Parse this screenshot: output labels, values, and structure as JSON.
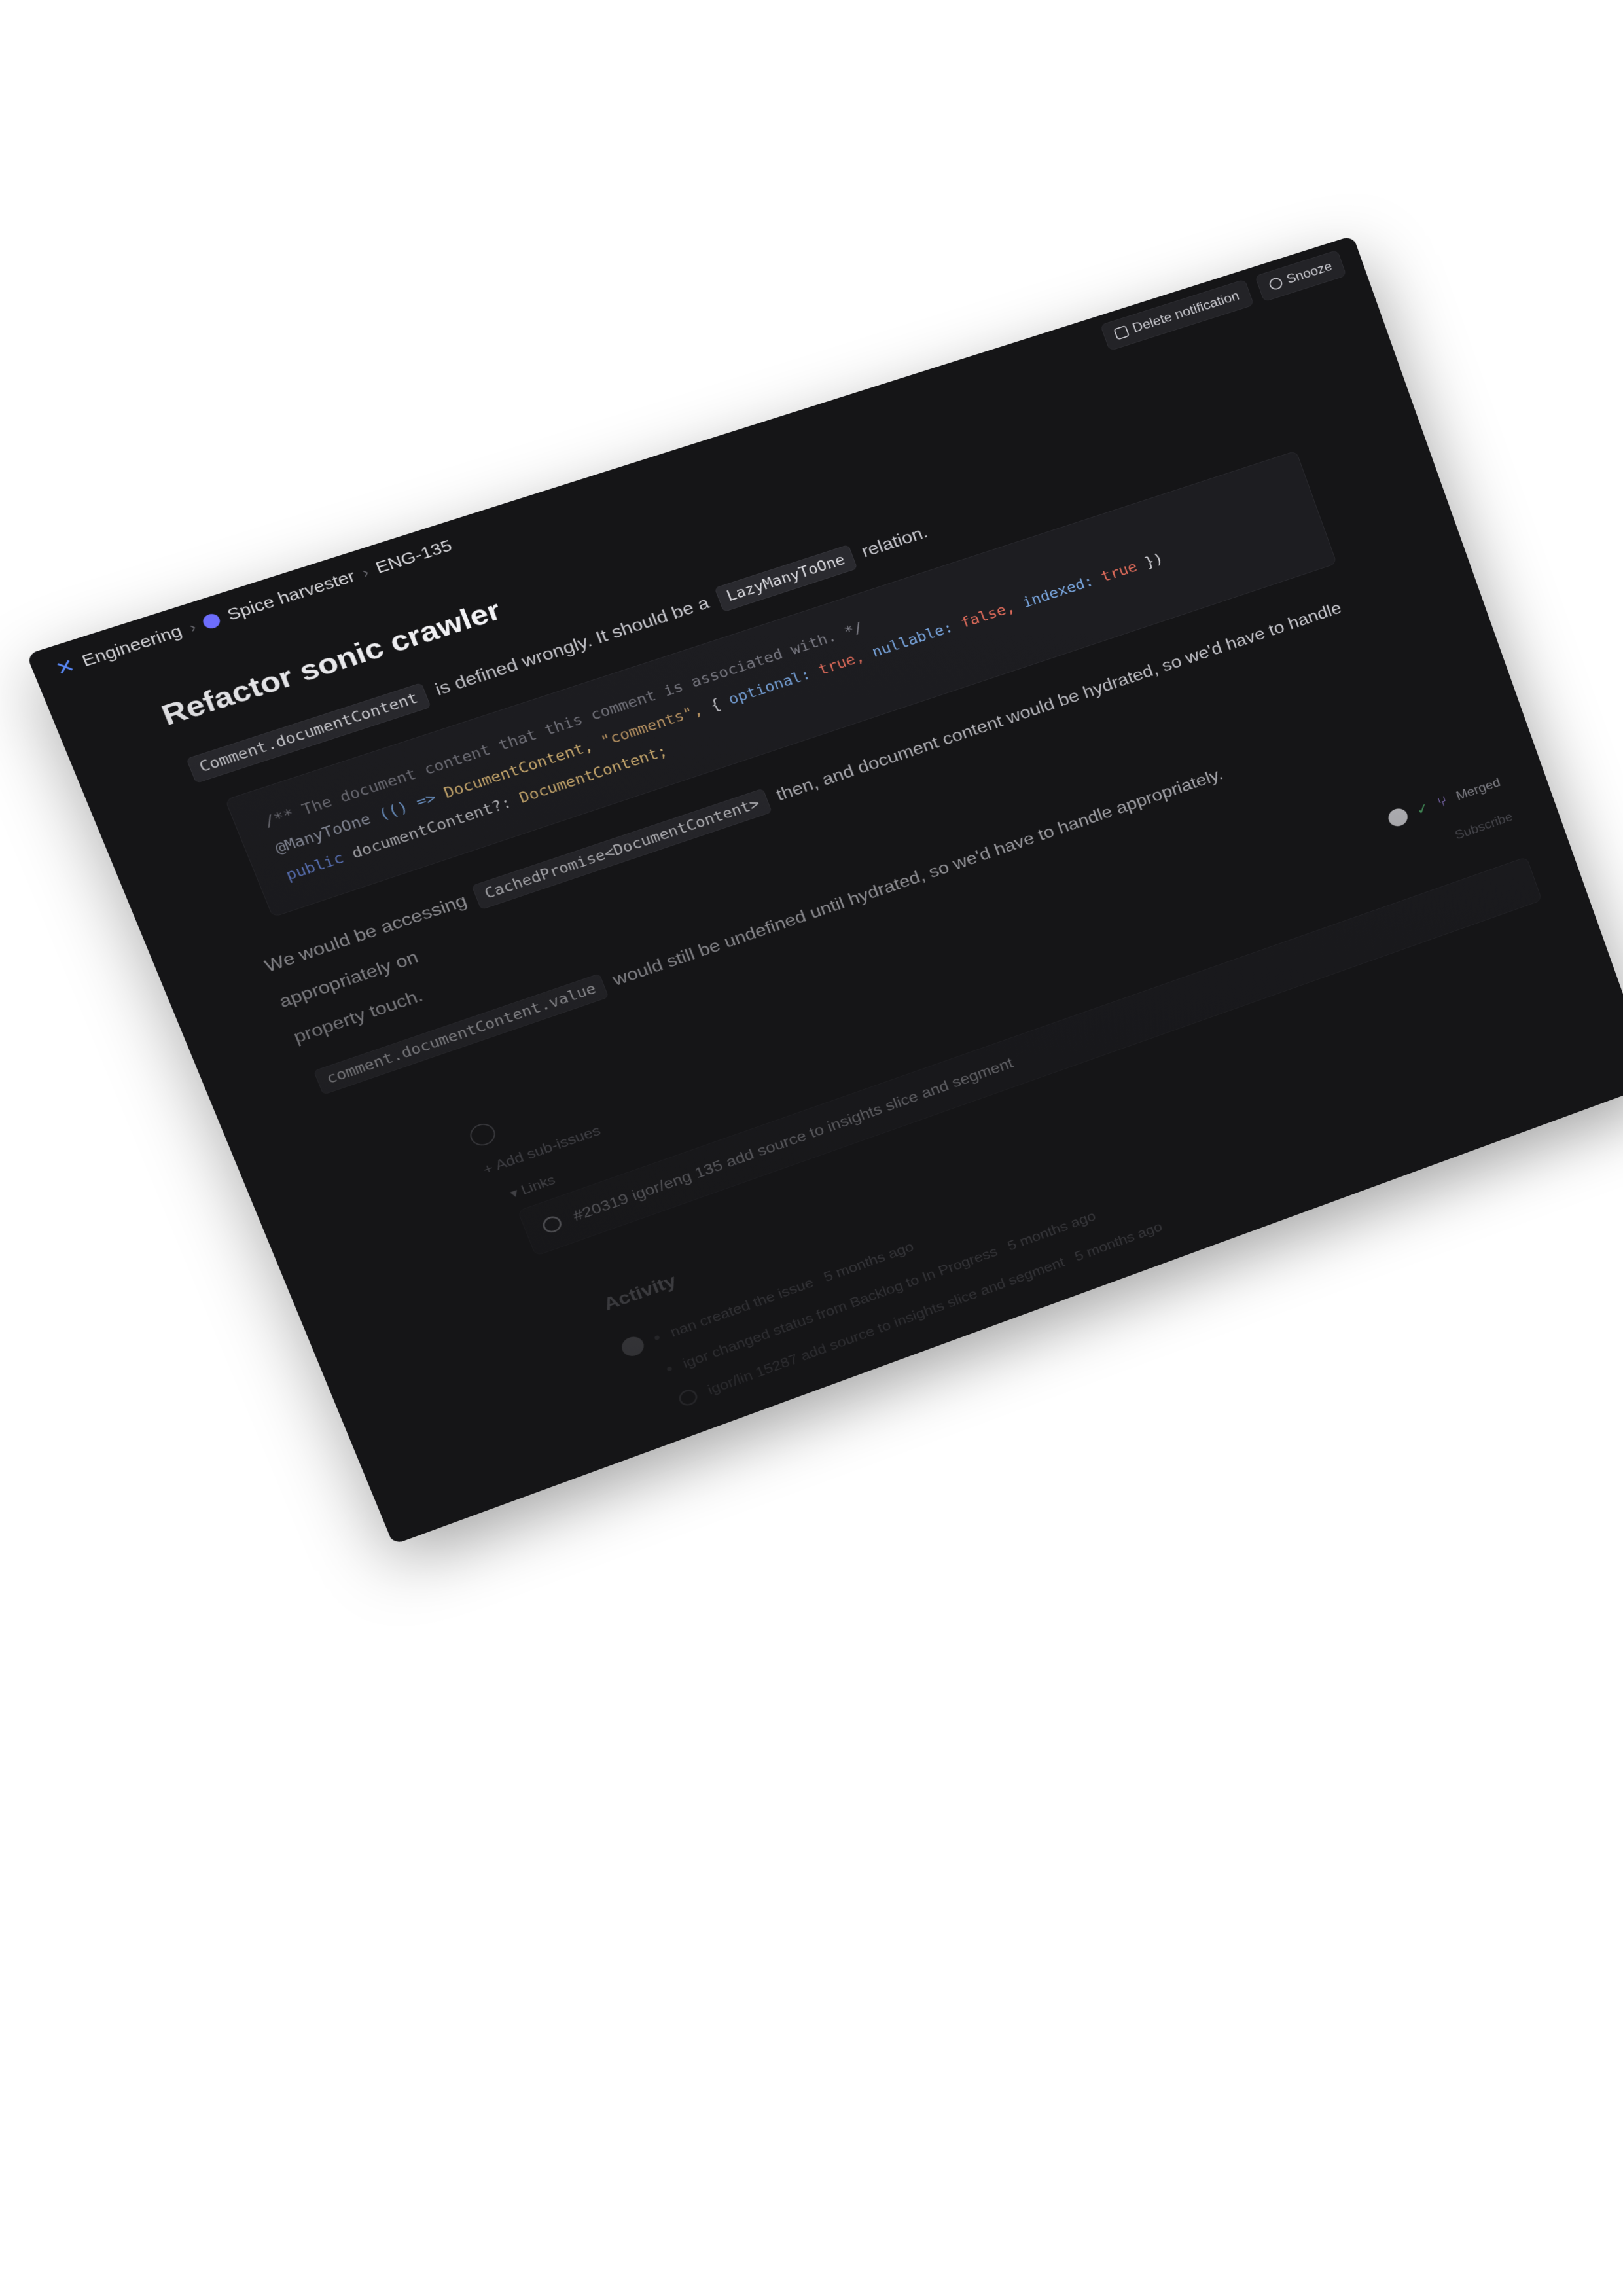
{
  "breadcrumb": {
    "team": "Engineering",
    "project": "Spice harvester",
    "issue_id": "ENG-135"
  },
  "toolbar": {
    "delete_notification": "Delete notification",
    "snooze": "Snooze"
  },
  "issue": {
    "title": "Refactor sonic crawler",
    "para1_code": "Comment.documentContent",
    "para1_text": "is defined wrongly. It should be a",
    "para1_code2": "LazyManyToOne",
    "para1_end": "relation.",
    "code_line1_comment": "/** The document content that this comment is associated with. */",
    "code_line2_deco": "@ManyToOne",
    "code_line2_arrow": "(() =>",
    "code_line2_type": "DocumentContent,",
    "code_line2_str": "\"comments\",",
    "code_line2_brace": "{",
    "code_line2_k1": "optional:",
    "code_line2_v1": "true,",
    "code_line2_k2": "nullable:",
    "code_line2_v2": "false,",
    "code_line2_k3": "indexed:",
    "code_line2_v3": "true",
    "code_line2_end": "})",
    "code_line3_kw": "public",
    "code_line3_prop": "documentContent?:",
    "code_line3_type": "DocumentContent;",
    "para2_start": "We would be accessing",
    "para2_code": "CachedPromise<DocumentContent>",
    "para2_text": "then, and document content would be hydrated, so we'd have to handle appropriately on",
    "para2_cont": "property touch.",
    "para3_code": "comment.documentContent.value",
    "para3_text": "would still be undefined until hydrated, so we'd have to handle appropriately."
  },
  "subissues": {
    "add_label": "+ Add sub-issues",
    "merge_label": "Merged",
    "subscribe": "Subscribe",
    "links_label": "▾ Links",
    "link_text": "#20319 igor/eng 135 add source to insights slice and segment"
  },
  "activity": {
    "heading": "Activity",
    "rows": [
      {
        "text": "nan created the issue",
        "time": "5 months ago"
      },
      {
        "text": "igor changed status from Backlog to In Progress",
        "time": "5 months ago"
      },
      {
        "text": "igor/lin 15287 add source to insights slice and segment",
        "time": "5 months ago"
      }
    ]
  },
  "colors": {
    "background": "#151517",
    "accent": "#5b8cff",
    "project": "#6d6dfc"
  }
}
